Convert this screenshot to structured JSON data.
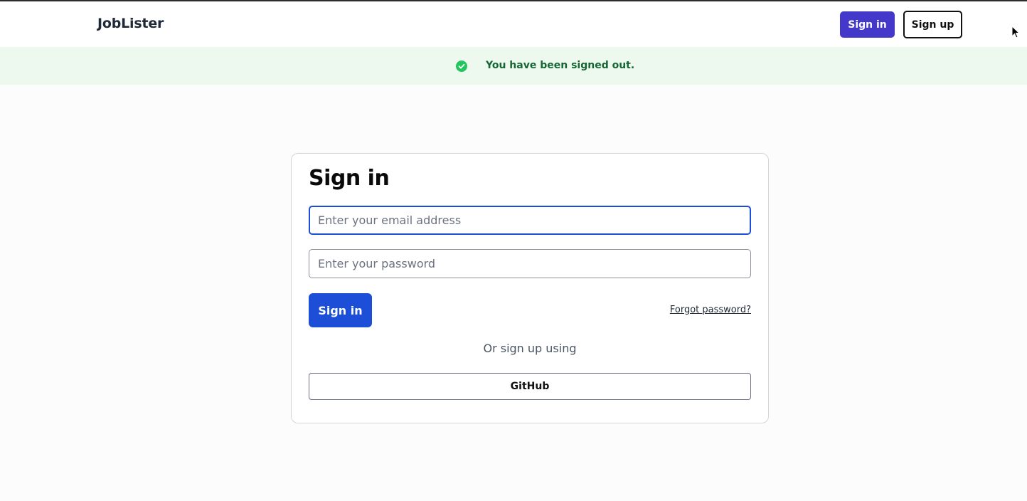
{
  "navbar": {
    "brand": "JobLister",
    "sign_in_label": "Sign in",
    "sign_up_label": "Sign up"
  },
  "flash": {
    "message": "You have been signed out.",
    "icon": "check-circle-icon",
    "color": "#166534",
    "background": "#edf9ef"
  },
  "form": {
    "title": "Sign in",
    "email_value": "",
    "email_placeholder": "Enter your email address",
    "password_value": "",
    "password_placeholder": "Enter your password",
    "submit_label": "Sign in",
    "forgot_label": "Forgot password?",
    "or_text": "Or sign up using",
    "github_label": "GitHub"
  },
  "colors": {
    "primary": "#1d4ed8",
    "nav_primary": "#4338ca",
    "success_icon": "#22c55e"
  }
}
